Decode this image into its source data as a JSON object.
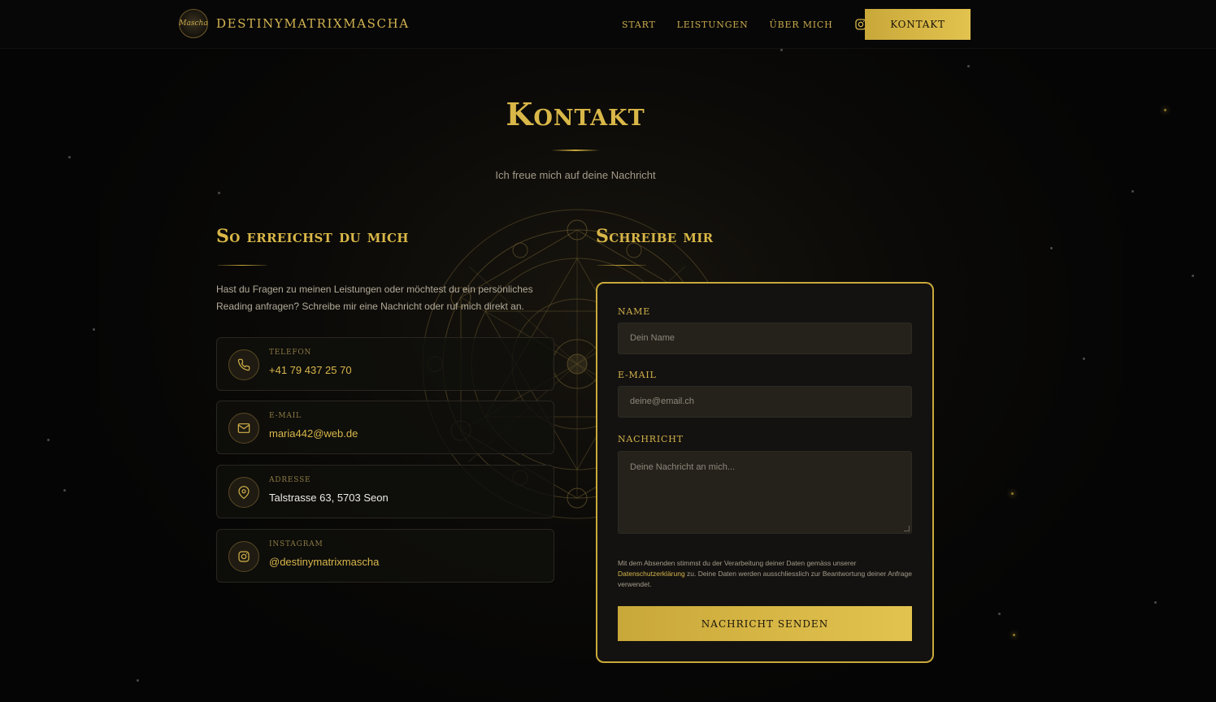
{
  "header": {
    "logo_text": "Mascha",
    "brand": "DESTINYMATRIXMASCHA",
    "nav": [
      "START",
      "LEISTUNGEN",
      "ÜBER MICH"
    ],
    "instagram_icon": "instagram-icon",
    "cta": "KONTAKT"
  },
  "hero": {
    "title": "Kontakt",
    "subtitle": "Ich freue mich auf deine Nachricht"
  },
  "contact": {
    "heading": "So erreichst du mich",
    "intro": "Hast du Fragen zu meinen Leistungen oder möchtest du ein persönliches Reading anfragen? Schreibe mir eine Nachricht oder ruf mich direkt an.",
    "items": [
      {
        "label": "TELEFON",
        "value": "+41 79 437 25 70",
        "icon": "phone-icon"
      },
      {
        "label": "E-MAIL",
        "value": "maria442@web.de",
        "icon": "mail-icon"
      },
      {
        "label": "ADRESSE",
        "value": "Talstrasse 63, 5703 Seon",
        "icon": "map-pin-icon"
      },
      {
        "label": "INSTAGRAM",
        "value": "@destinymatrixmascha",
        "icon": "instagram-icon"
      }
    ]
  },
  "form": {
    "heading": "Schreibe mir",
    "name_label": "NAME",
    "name_placeholder": "Dein Name",
    "email_label": "E-MAIL",
    "email_placeholder": "deine@email.ch",
    "message_label": "NACHRICHT",
    "message_placeholder": "Deine Nachricht an mich...",
    "privacy_before": "Mit dem Absenden stimmst du der Verarbeitung deiner Daten gemäss unserer ",
    "privacy_link": "Datenschutzerklärung",
    "privacy_after": " zu. Deine Daten werden ausschliesslich zur Beantwortung deiner Anfrage verwendet.",
    "submit": "NACHRICHT SENDEN"
  },
  "colors": {
    "gold": "#d9b748",
    "background": "#050505",
    "form_border": "#c9a93a"
  }
}
